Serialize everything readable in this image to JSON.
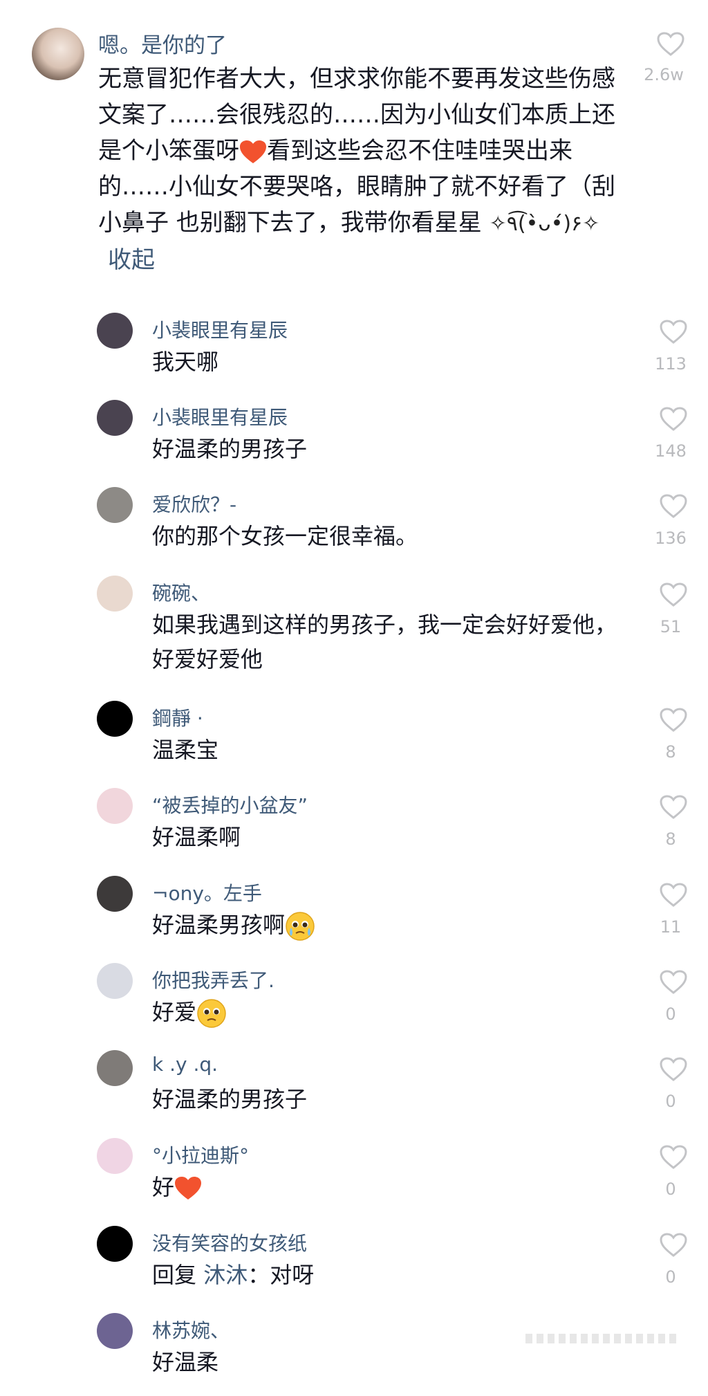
{
  "main_comment": {
    "author": "嗯。是你的了",
    "text": "无意冒犯作者大大，但求求你能不要再发这些伤感文案了……会很残忍的……因为小仙女们本质上还是个小笨蛋呀",
    "text_after_heart": "看到这些会忍不住哇哇哭出来的……小仙女不要哭咯，眼睛肿了就不好看了（刮小鼻子 也别翻下去了，我带你看星星",
    "sparkles": "✧٩͡(•̀ᴗ•́)۶✧",
    "collapse_label": "收起",
    "likes": "2.6w"
  },
  "replies": [
    {
      "name": "小裴眼里有星辰",
      "text": "我天哪",
      "likes": "113",
      "avatar_color": "#4a4350"
    },
    {
      "name": "小裴眼里有星辰",
      "text": "好温柔的男孩子",
      "likes": "148",
      "avatar_color": "#4a4350"
    },
    {
      "name": "爱欣欣？-",
      "text": "你的那个女孩一定很幸福。",
      "likes": "136",
      "avatar_color": "#8d8a86"
    },
    {
      "name": "碗碗、",
      "text": "如果我遇到这样的男孩子，我一定会好好爱他，好爱好爱他",
      "likes": "51",
      "avatar_color": "#e9d9cf"
    },
    {
      "name": "鋼靜 ·",
      "text": "温柔宝",
      "likes": "8",
      "avatar_color": "#000000"
    },
    {
      "name": "“被丢掉的小盆友”",
      "text": "好温柔啊",
      "likes": "8",
      "avatar_color": "#f1d6dc"
    },
    {
      "name": "¬ony。左手",
      "text": "好温柔男孩啊",
      "likes": "11",
      "avatar_color": "#3d3a3a"
    },
    {
      "name": "你把我弄丢了.",
      "text": "好爱",
      "likes": "0",
      "avatar_color": "#d9dbe3"
    },
    {
      "name": "k .y .q.",
      "text": "好温柔的男孩子",
      "likes": "0",
      "avatar_color": "#7f7b78"
    },
    {
      "name": "°小拉迪斯°",
      "text": "好",
      "likes": "0",
      "avatar_color": "#f0d5e4"
    },
    {
      "name": "没有笑容的女孩纸",
      "reply_prefix": "回复",
      "reply_to": "沐沐",
      "text": "：对呀",
      "likes": "0",
      "avatar_color": "#000000"
    },
    {
      "name": "林苏婉、",
      "text": "好温柔",
      "likes": "",
      "avatar_color": "#6d6492"
    }
  ],
  "colors": {
    "name": "#3f5a78",
    "text": "#161823",
    "count": "#b9babd",
    "heart_emoji": "#f2522e"
  },
  "icons": [
    "heart-outline-icon",
    "red-heart-emoji",
    "pleading-face-emoji",
    "crying-face-emoji"
  ]
}
